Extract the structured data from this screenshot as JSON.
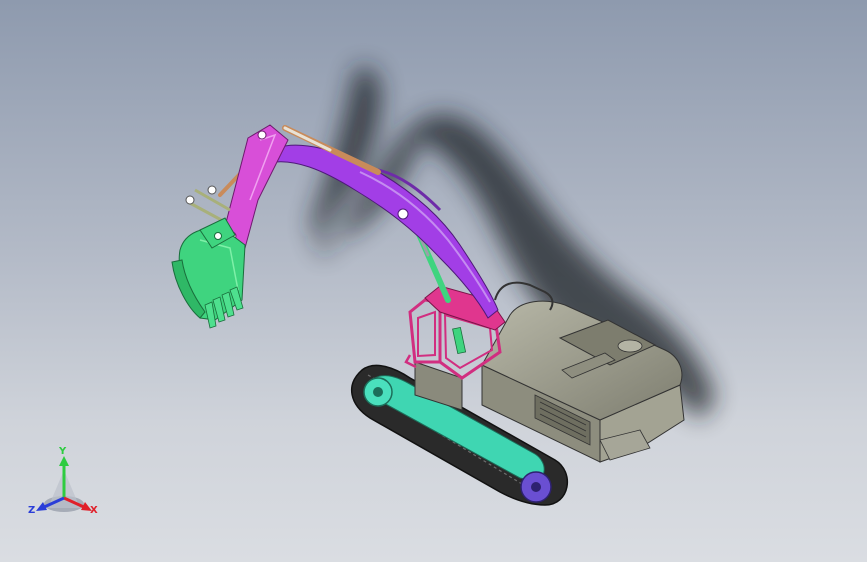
{
  "viewport": {
    "background_top": "#8e9aae",
    "background_bottom": "#dadde2"
  },
  "model": {
    "colors": {
      "bucket": "#3fd47f",
      "stick": "#d84fd8",
      "boom": "#a23ee6",
      "cab_frame": "#d12e80",
      "cab_roof": "#e0368e",
      "body": "#9a9a88",
      "track_frame": "#3fd6b2",
      "track": "#2a2a2a",
      "idler": "#6a4fd2",
      "cylinder": "#c98b5a"
    }
  },
  "triad": {
    "y_label": "Y",
    "x_label": "X",
    "z_label": "Z",
    "y_color": "#2ecc40",
    "x_color": "#e0202a",
    "z_color": "#2a3ed8"
  }
}
